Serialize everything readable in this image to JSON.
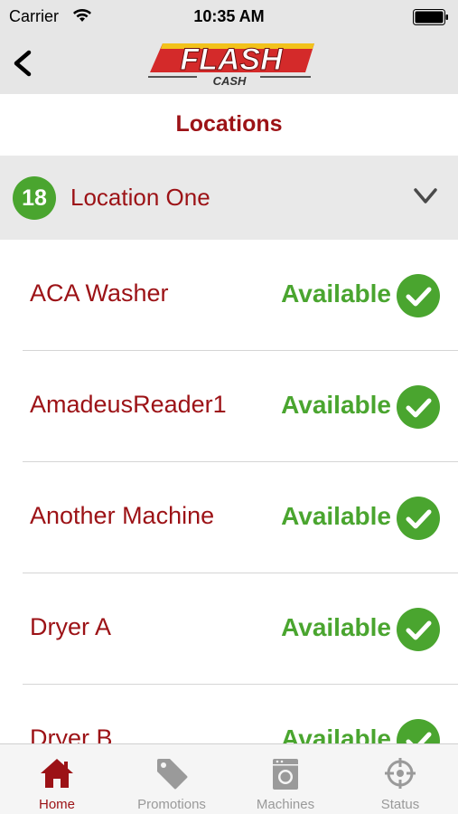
{
  "status_bar": {
    "carrier": "Carrier",
    "time": "10:35 AM"
  },
  "nav": {
    "back_icon": "chevron-left-icon",
    "logo_text": "FLASH",
    "logo_subtext": "CASH"
  },
  "page": {
    "title": "Locations"
  },
  "location": {
    "badge": "18",
    "name": "Location One",
    "expand_icon": "chevron-down-icon"
  },
  "machines": [
    {
      "name": "ACA Washer",
      "status": "Available"
    },
    {
      "name": "AmadeusReader1",
      "status": "Available"
    },
    {
      "name": "Another Machine",
      "status": "Available"
    },
    {
      "name": "Dryer A",
      "status": "Available"
    },
    {
      "name": "Dryer B",
      "status": "Available"
    }
  ],
  "tabs": [
    {
      "label": "Home",
      "icon": "home-icon",
      "active": true
    },
    {
      "label": "Promotions",
      "icon": "tag-icon",
      "active": false
    },
    {
      "label": "Machines",
      "icon": "washer-icon",
      "active": false
    },
    {
      "label": "Status",
      "icon": "crosshair-icon",
      "active": false
    }
  ],
  "colors": {
    "accent_red": "#9c1216",
    "available_green": "#4aa52f",
    "bar_gray": "#e6e6e6"
  }
}
